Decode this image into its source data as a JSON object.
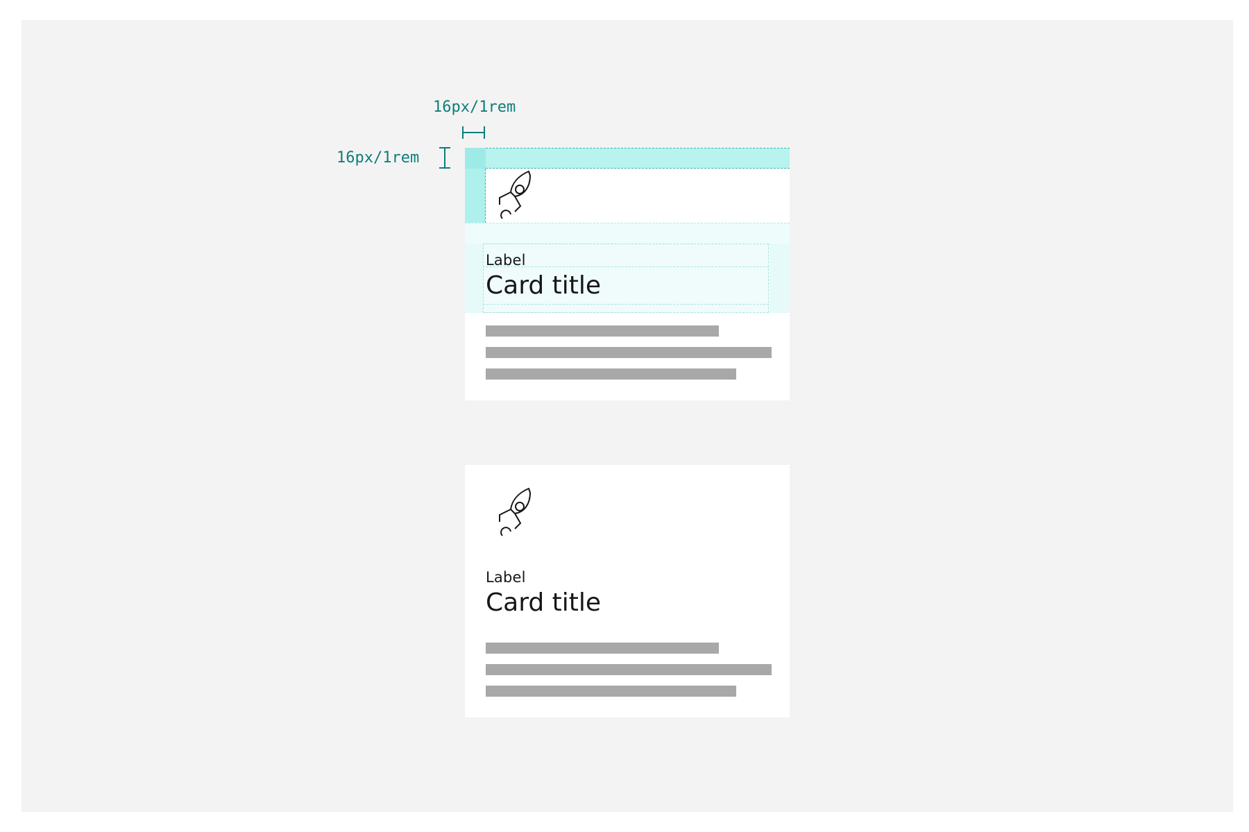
{
  "annotations": {
    "horizontal_spacing": "16px/1rem",
    "vertical_spacing": "16px/1rem"
  },
  "colors": {
    "background": "#f3f3f3",
    "card": "#ffffff",
    "highlight": "#b8f3f0",
    "annotation": "#0f7d7a",
    "placeholder_line": "#a8a8a8"
  },
  "cards": [
    {
      "variant": "annotated",
      "icon": "rocket-icon",
      "label": "Label",
      "title": "Card title"
    },
    {
      "variant": "plain",
      "icon": "rocket-icon",
      "label": "Label",
      "title": "Card title"
    }
  ]
}
